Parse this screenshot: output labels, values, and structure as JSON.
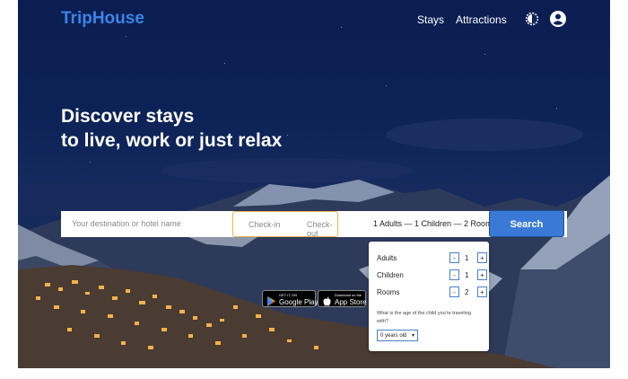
{
  "header": {
    "logo": "TripHouse",
    "nav": {
      "stays": "Stays",
      "attractions": "Attractions"
    }
  },
  "hero": {
    "headline_line1": "Discover stays",
    "headline_line2": "to live, work or just relax"
  },
  "search": {
    "destination_placeholder": "Your destination or hotel name",
    "checkin_label": "Check-in",
    "checkout_label": "Check-out",
    "occupancy_summary": "1 Adults — 1 Children — 2 Room",
    "search_label": "Search"
  },
  "occupancy_dropdown": {
    "adults": {
      "label": "Adults",
      "value": "1"
    },
    "children": {
      "label": "Children",
      "value": "1"
    },
    "rooms": {
      "label": "Rooms",
      "value": "2"
    },
    "minus": "-",
    "plus": "+",
    "child_age_question": "What is the age of the child you're traveling with?",
    "child_age_selected": "0 years old"
  },
  "app_badges": {
    "google_small": "GET IT ON",
    "google_big": "Google Play",
    "apple_small": "Download on the",
    "apple_big": "App Store"
  },
  "colors": {
    "brand": "#3c84e6",
    "search_button": "#3a7ad6",
    "dates_border": "#e5b54f"
  }
}
